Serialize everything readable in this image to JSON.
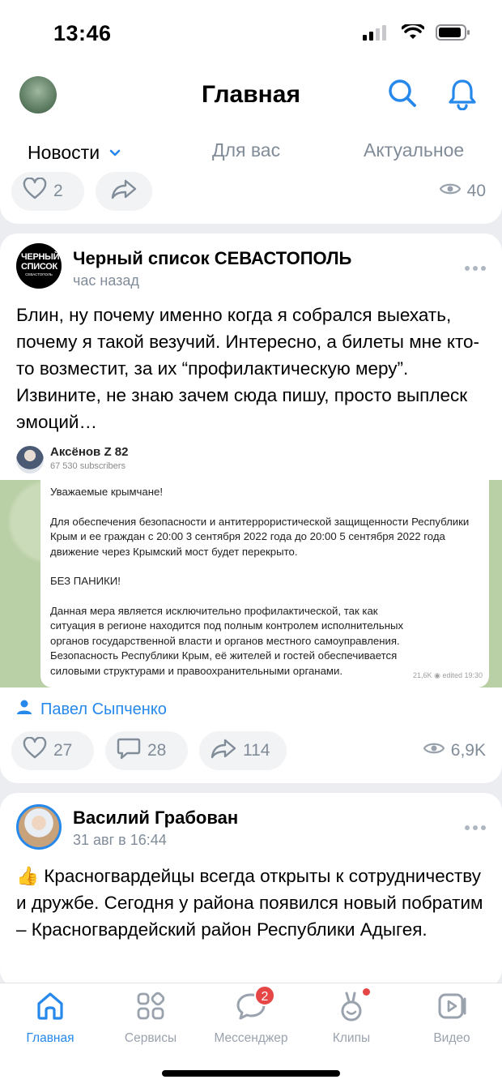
{
  "status": {
    "time": "13:46"
  },
  "header": {
    "title": "Главная"
  },
  "tabs": [
    {
      "label": "Новости",
      "active": true
    },
    {
      "label": "Для вас",
      "active": false
    },
    {
      "label": "Актуальное",
      "active": false
    }
  ],
  "top_post": {
    "likes": "2",
    "views": "40"
  },
  "post1": {
    "author": "Черный список СЕВАСТОПОЛЬ",
    "avatar_text": "ЧЕРНЫЙ СПИСОК",
    "avatar_small": "СЕВАСТОПОЛЬ",
    "time": "час назад",
    "text": "Блин, ну почему именно когда я собрался выехать, почему я такой везучий. Интересно, а билеты мне кто-то возместит, за их “профилактическую меру”. Извините, не знаю зачем сюда пишу, просто выплеск эмоций…",
    "repost": {
      "author": "Аксёнов Z 82",
      "subscribers": "67 530 subscribers",
      "message": {
        "p1": "Уважаемые крымчане!",
        "p2": "Для обеспечения безопасности и антитеррористической защищенности Республики Крым и ее граждан с 20:00 3 сентября 2022 года до 20:00 5 сентября 2022 года движение через Крымский мост будет перекрыто.",
        "p3": "БЕЗ ПАНИКИ!",
        "p4": "Данная мера является исключительно профилактической, так как ситуация в регионе находится под полным контролем исполнительных органов государственной власти и органов местного самоуправления. Безопасность Республики Крым, её жителей и гостей обеспечивается силовыми структурами и правоохранительными органами.",
        "views": "21,6K",
        "edited": "edited 19:30"
      }
    },
    "signer": "Павел Сыпченко",
    "likes": "27",
    "comments": "28",
    "shares": "114",
    "views": "6,9K"
  },
  "post2": {
    "author": "Василий Грабован",
    "time": "31 авг в 16:44",
    "emoji": "👍",
    "text": "Красногвардейцы всегда открыты к сотрудничеству и дружбе. Сегодня у района появился новый побратим – Красногвардейский район Республики Адыгея."
  },
  "tabbar": {
    "items": [
      {
        "label": "Главная",
        "icon": "home-icon",
        "active": true
      },
      {
        "label": "Сервисы",
        "icon": "services-icon",
        "active": false
      },
      {
        "label": "Мессенджер",
        "icon": "messenger-icon",
        "active": false,
        "badge": "2"
      },
      {
        "label": "Клипы",
        "icon": "clips-icon",
        "active": false
      },
      {
        "label": "Видео",
        "icon": "video-icon",
        "active": false
      }
    ]
  },
  "colors": {
    "accent": "#2688eb",
    "secondary_text": "#818c99",
    "badge": "#e64646"
  }
}
